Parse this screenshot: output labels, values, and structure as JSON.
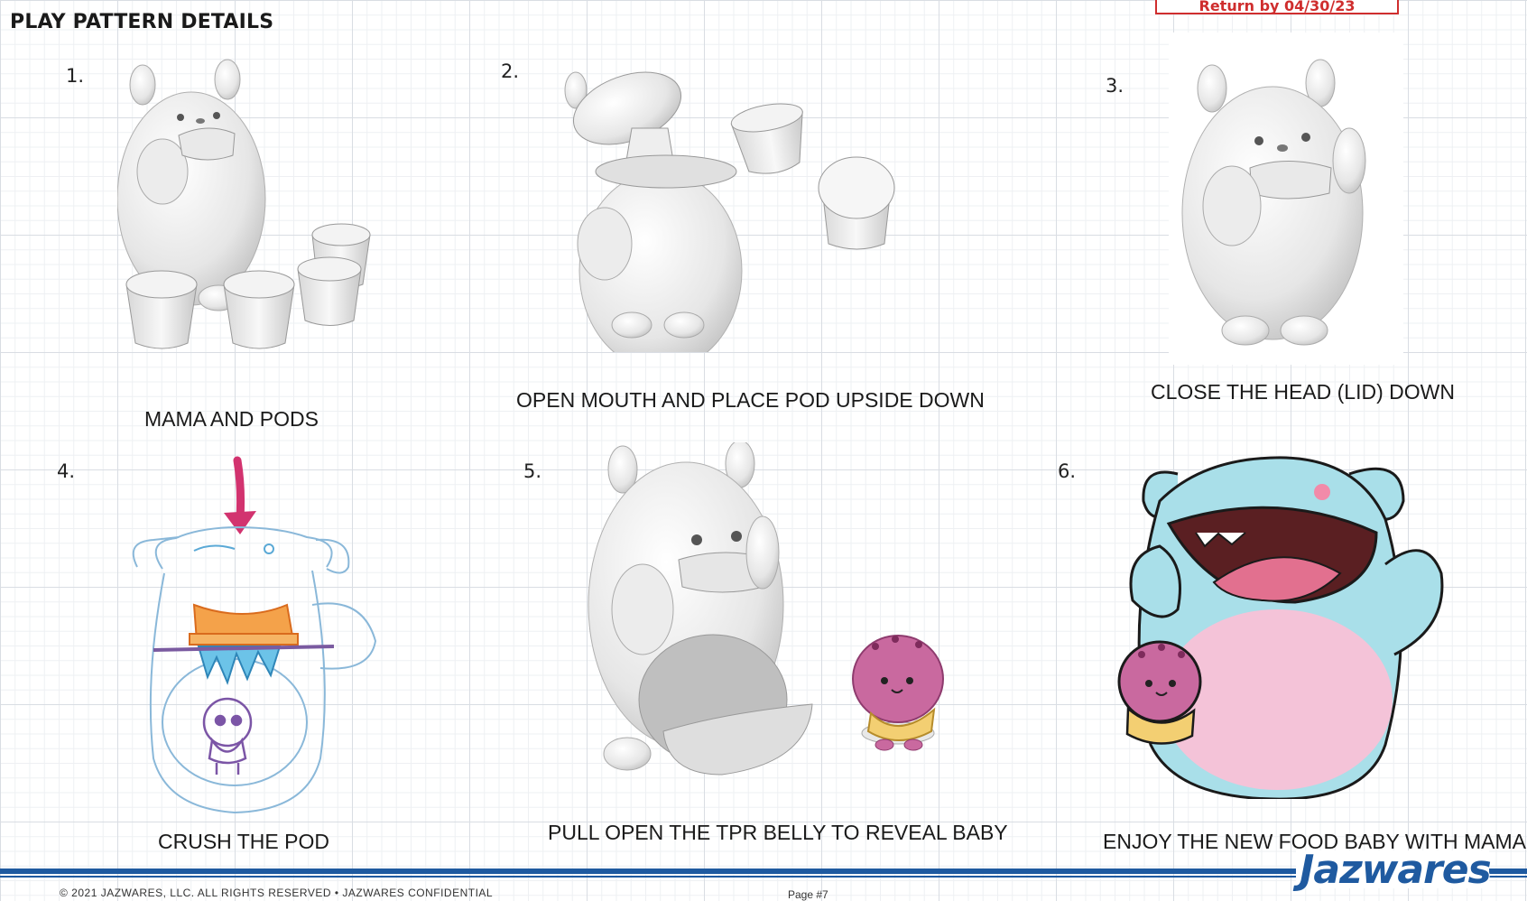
{
  "page": {
    "title": "PLAY PATTERN DETAILS",
    "return_notice": "Return by 04/30/23"
  },
  "steps": [
    {
      "number": "1.",
      "caption": "MAMA AND PODS"
    },
    {
      "number": "2.",
      "caption": "OPEN MOUTH AND PLACE POD UPSIDE DOWN"
    },
    {
      "number": "3.",
      "caption": "CLOSE THE HEAD (LID) DOWN"
    },
    {
      "number": "4.",
      "caption": "CRUSH THE POD"
    },
    {
      "number": "5.",
      "caption": "PULL OPEN THE TPR BELLY TO REVEAL BABY"
    },
    {
      "number": "6.",
      "caption": "ENJOY THE NEW FOOD BABY WITH MAMA"
    }
  ],
  "footer": {
    "copyright": "© 2021 JAZWARES, LLC. ALL RIGHTS RESERVED • JAZWARES CONFIDENTIAL",
    "page_label": "Page #7",
    "brand": "Jazwares"
  },
  "colors": {
    "accent_blue": "#1f5aa0",
    "return_red": "#cf2e2e",
    "arrow_pink": "#d2336f",
    "mama_blue": "#a9dfe9",
    "belly_pink": "#f4c3d8",
    "baby_purple": "#c9699f",
    "baby_yellow": "#f3cf72"
  }
}
